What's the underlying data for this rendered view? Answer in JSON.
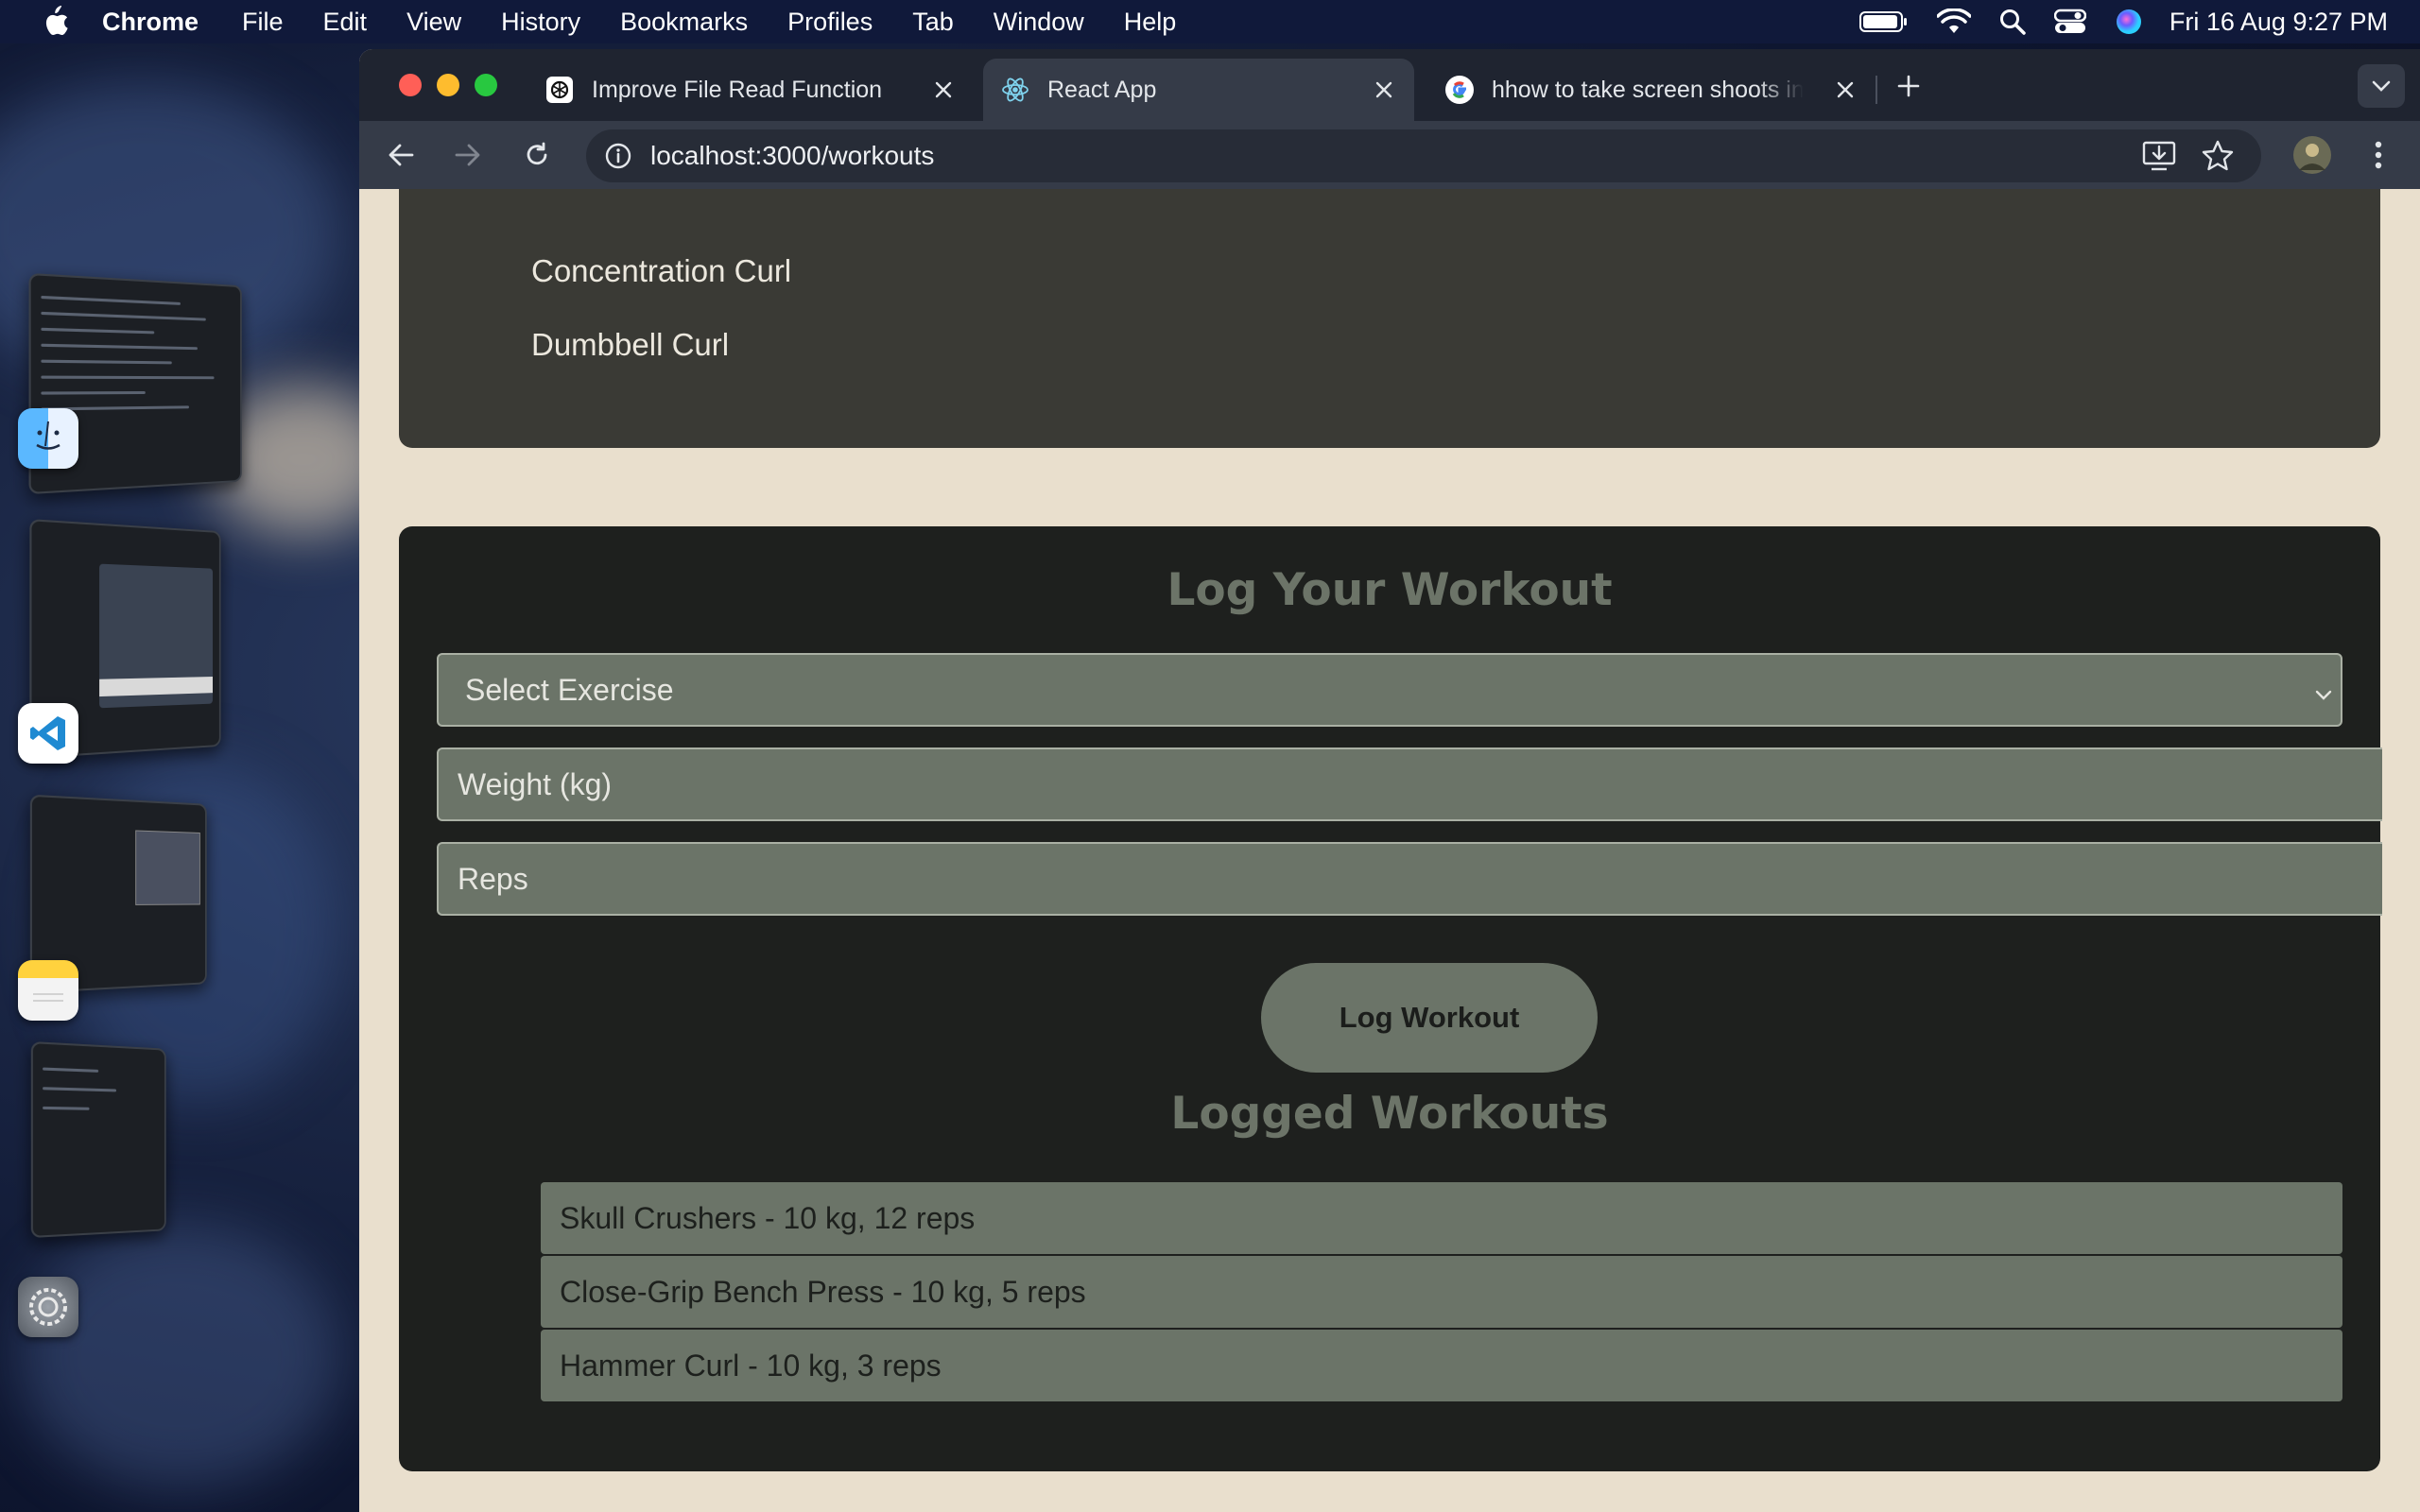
{
  "menubar": {
    "app_name": "Chrome",
    "items": [
      "File",
      "Edit",
      "View",
      "History",
      "Bookmarks",
      "Profiles",
      "Tab",
      "Window",
      "Help"
    ],
    "clock": "Fri 16 Aug  9:27 PM"
  },
  "browser": {
    "tabs": [
      {
        "title": "Improve File Read Function",
        "favicon": "openai-icon",
        "active": false
      },
      {
        "title": "React App",
        "favicon": "react-icon",
        "active": true
      },
      {
        "title": "hhow to take screen shoots in",
        "favicon": "google-icon",
        "active": false
      }
    ],
    "url": "localhost:3000/workouts"
  },
  "exercises": {
    "items": [
      "Concentration Curl",
      "Dumbbell Curl"
    ]
  },
  "log_form": {
    "title": "Log Your Workout",
    "select_placeholder": "Select Exercise",
    "weight_placeholder": "Weight (kg)",
    "reps_placeholder": "Reps",
    "submit_label": "Log Workout"
  },
  "logged": {
    "title": "Logged Workouts",
    "entries": [
      "Skull Crushers - 10 kg, 12 reps",
      "Close-Grip Bench Press - 10 kg, 5 reps",
      "Hammer Curl - 10 kg, 3 reps"
    ]
  },
  "colors": {
    "menubar": "#10193a",
    "tabstrip": "#1f2430",
    "toolbar": "#353b48",
    "page_bg": "#e9dfcd",
    "card_dark": "#1e201e",
    "card_exercises": "#3a3a35",
    "field": "#6b7468",
    "heading": "#6c7468"
  }
}
